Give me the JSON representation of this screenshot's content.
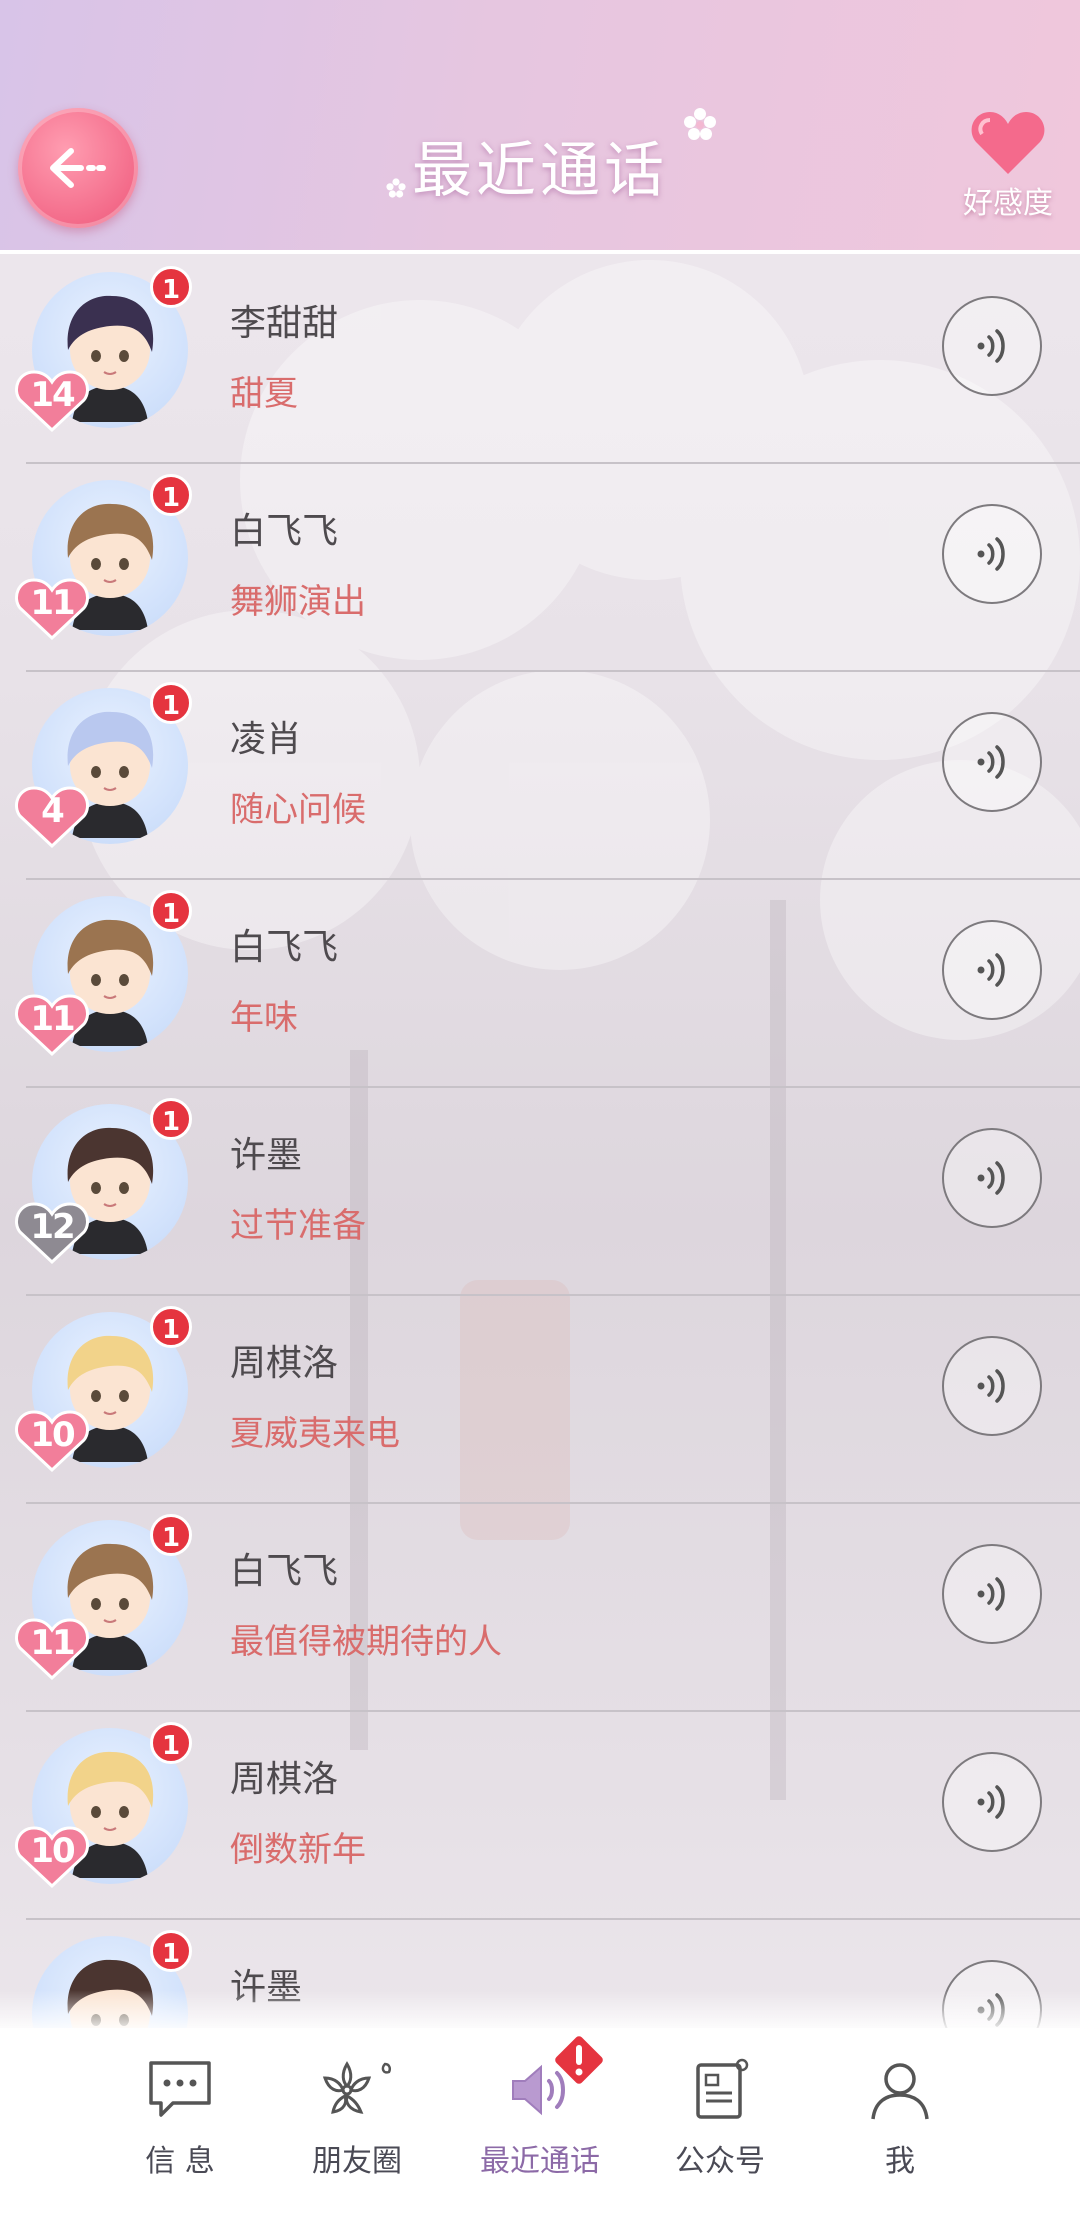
{
  "header": {
    "title": "最近通话",
    "affinity_label": "好感度"
  },
  "calls": [
    {
      "name": "李甜甜",
      "subject": "甜夏",
      "unread": "1",
      "level": "14",
      "level_color": "#f27e9a"
    },
    {
      "name": "白飞飞",
      "subject": "舞狮演出",
      "unread": "1",
      "level": "11",
      "level_color": "#f27e9a"
    },
    {
      "name": "凌肖",
      "subject": "随心问候",
      "unread": "1",
      "level": "4",
      "level_color": "#f27e9a"
    },
    {
      "name": "白飞飞",
      "subject": "年味",
      "unread": "1",
      "level": "11",
      "level_color": "#f27e9a"
    },
    {
      "name": "许墨",
      "subject": "过节准备",
      "unread": "1",
      "level": "12",
      "level_color": "#8e8a92"
    },
    {
      "name": "周棋洛",
      "subject": "夏威夷来电",
      "unread": "1",
      "level": "10",
      "level_color": "#f27e9a"
    },
    {
      "name": "白飞飞",
      "subject": "最值得被期待的人",
      "unread": "1",
      "level": "11",
      "level_color": "#f27e9a"
    },
    {
      "name": "周棋洛",
      "subject": "倒数新年",
      "unread": "1",
      "level": "10",
      "level_color": "#f27e9a"
    },
    {
      "name": "许墨",
      "subject": "",
      "unread": "1",
      "level": "",
      "level_color": "#f27e9a"
    }
  ],
  "nav": {
    "messages": "信 息",
    "moments": "朋友圈",
    "recent_calls": "最近通话",
    "official": "公众号",
    "me": "我"
  },
  "colors": {
    "accent_pink": "#f36a89",
    "subject_red": "#d96c6c",
    "badge_red": "#e5343f",
    "active_nav": "#8c6aa7"
  }
}
